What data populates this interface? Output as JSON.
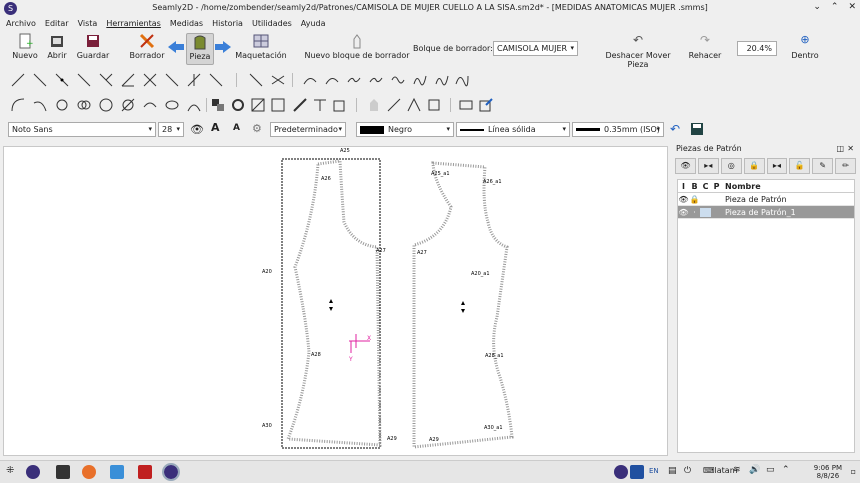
{
  "window": {
    "title": "Seamly2D - /home/zombender/seamly2d/Patrones/CAMISOLA DE MUJER CUELLO A LA SISA.sm2d* - [MEDIDAS ANATOMICAS MUJER .smms]",
    "app_icon": "S",
    "buttons": [
      "⌄",
      "⌃",
      "✕"
    ]
  },
  "menu": [
    "Archivo",
    "Editar",
    "Vista",
    "Herramientas",
    "Medidas",
    "Historia",
    "Utilidades",
    "Ayuda"
  ],
  "toolbar": {
    "nuevo": "Nuevo",
    "abrir": "Abrir",
    "guardar": "Guardar",
    "borrador": "Borrador",
    "pieza": "Pieza",
    "maquetacion": "Maquetación",
    "nuevo_bloque": "Nuevo bloque de borrador",
    "bloque_label": "Bolque de borrador:",
    "bloque_value": "CAMISOLA MUJER",
    "deshacer": "Deshacer Mover Pieza",
    "rehacer": "Rehacer",
    "zoom": "20.4%",
    "dentro": "Dentro"
  },
  "props": {
    "font": "Noto Sans",
    "size": "28",
    "default": "Predeterminado",
    "color": "Negro",
    "line": "Línea sólida",
    "width": "0.35mm (ISO)"
  },
  "canvas": {
    "labels_left": [
      "A25",
      "A26",
      "A27",
      "A20",
      "A28",
      "A30",
      "A29"
    ],
    "labels_right": [
      "A25_a1",
      "A26_a1",
      "A27",
      "A20_a1",
      "A28_a1",
      "A30_a1",
      "A29"
    ],
    "axis_x": "X",
    "axis_y": "Y",
    "colors": {
      "accent": "#e020a0",
      "seam": "#888888"
    }
  },
  "panel": {
    "title": "Piezas de Patrón",
    "headers": [
      "I",
      "B",
      "C",
      "P",
      "Nombre"
    ],
    "rows": [
      {
        "name": "Pieza de Patrón",
        "selected": false
      },
      {
        "name": "Pieza de Patrón_1",
        "selected": true
      }
    ]
  },
  "taskbar": {
    "lang": "EN",
    "kb": "latam",
    "time": "9:06 PM",
    "date": "8/8/26"
  }
}
